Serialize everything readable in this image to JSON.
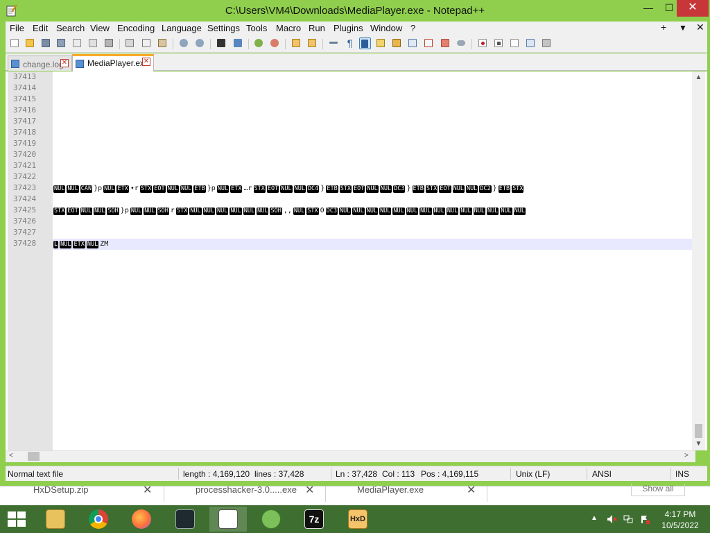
{
  "window": {
    "title": "C:\\Users\\VM4\\Downloads\\MediaPlayer.exe - Notepad++",
    "minimize_glyph": "—",
    "maximize_glyph": "☐",
    "close_glyph": "✕"
  },
  "menu": {
    "items": [
      "File",
      "Edit",
      "Search",
      "View",
      "Encoding",
      "Language",
      "Settings",
      "Tools",
      "Macro",
      "Run",
      "Plugins",
      "Window",
      "?"
    ],
    "right": [
      "+",
      "▼",
      "✕"
    ]
  },
  "toolbar": {
    "icons": [
      "new-file-icon",
      "open-file-icon",
      "save-icon",
      "save-all-icon",
      "close-icon",
      "close-all-icon",
      "print-icon",
      "cut-icon",
      "copy-icon",
      "paste-icon",
      "undo-icon",
      "redo-icon",
      "find-icon",
      "replace-icon",
      "zoom-in-icon",
      "zoom-out-icon",
      "sync-vertical-icon",
      "sync-horizontal-icon",
      "word-wrap-icon",
      "show-all-chars-icon",
      "indent-guide-icon",
      "udl-icon",
      "doc-map-icon",
      "function-list-icon",
      "folder-workspace-icon",
      "monitoring-icon",
      "record-macro-icon",
      "stop-record-icon",
      "play-macro-icon",
      "run-macro-multiple-icon",
      "save-macro-icon"
    ],
    "show_all_chars_glyph": "¶"
  },
  "tabs": [
    {
      "label": "change.log",
      "active": false
    },
    {
      "label": "MediaPlayer.exe",
      "active": true
    }
  ],
  "tab_close_glyph": "✕",
  "editor": {
    "line_numbers": [
      "37413",
      "37414",
      "37415",
      "37416",
      "37417",
      "37418",
      "37419",
      "37420",
      "37421",
      "37422",
      "37423",
      "37424",
      "37425",
      "37426",
      "37427",
      "37428"
    ],
    "current_line": "37428",
    "lines": [
      {
        "line": "37423",
        "tokens": [
          {
            "t": "c",
            "v": "NUL"
          },
          {
            "t": "c",
            "v": "NUL"
          },
          {
            "t": "c",
            "v": "CAN"
          },
          {
            "t": "s",
            "v": "}p"
          },
          {
            "t": "c",
            "v": "NUL"
          },
          {
            "t": "c",
            "v": "ETX"
          },
          {
            "t": "s",
            "v": "•r"
          },
          {
            "t": "c",
            "v": "STX"
          },
          {
            "t": "c",
            "v": "EOT"
          },
          {
            "t": "c",
            "v": "NUL"
          },
          {
            "t": "c",
            "v": "NUL"
          },
          {
            "t": "c",
            "v": "ETB"
          },
          {
            "t": "s",
            "v": "}p"
          },
          {
            "t": "c",
            "v": "NUL"
          },
          {
            "t": "c",
            "v": "ETX"
          },
          {
            "t": "s",
            "v": "…r"
          },
          {
            "t": "c",
            "v": "STX"
          },
          {
            "t": "c",
            "v": "EOT"
          },
          {
            "t": "c",
            "v": "NUL"
          },
          {
            "t": "c",
            "v": "NUL"
          },
          {
            "t": "c",
            "v": "DC4"
          },
          {
            "t": "s",
            "v": "}"
          },
          {
            "t": "c",
            "v": "ETB"
          },
          {
            "t": "c",
            "v": "STX"
          },
          {
            "t": "c",
            "v": "EOT"
          },
          {
            "t": "c",
            "v": "NUL"
          },
          {
            "t": "c",
            "v": "NUL"
          },
          {
            "t": "c",
            "v": "DC3"
          },
          {
            "t": "s",
            "v": "}"
          },
          {
            "t": "c",
            "v": "ETB"
          },
          {
            "t": "c",
            "v": "STX"
          },
          {
            "t": "c",
            "v": "EOT"
          },
          {
            "t": "c",
            "v": "NUL"
          },
          {
            "t": "c",
            "v": "NUL"
          },
          {
            "t": "c",
            "v": "DC2"
          },
          {
            "t": "s",
            "v": "}"
          },
          {
            "t": "c",
            "v": "ETB"
          },
          {
            "t": "c",
            "v": "STX"
          }
        ]
      },
      {
        "line": "37425",
        "tokens": [
          {
            "t": "c",
            "v": "STX"
          },
          {
            "t": "c",
            "v": "EOT"
          },
          {
            "t": "c",
            "v": "NUL"
          },
          {
            "t": "c",
            "v": "NUL"
          },
          {
            "t": "c",
            "v": "SOH"
          },
          {
            "t": "s",
            "v": "}p"
          },
          {
            "t": "c",
            "v": "NUL"
          },
          {
            "t": "c",
            "v": "NUL"
          },
          {
            "t": "c",
            "v": "SOH"
          },
          {
            "t": "s",
            "v": "r"
          },
          {
            "t": "c",
            "v": "STX"
          },
          {
            "t": "c",
            "v": "NUL"
          },
          {
            "t": "c",
            "v": "NUL"
          },
          {
            "t": "c",
            "v": "NUL"
          },
          {
            "t": "c",
            "v": "NUL"
          },
          {
            "t": "c",
            "v": "NUL"
          },
          {
            "t": "c",
            "v": "NUL"
          },
          {
            "t": "c",
            "v": "SOH"
          },
          {
            "t": "s",
            "v": ",,"
          },
          {
            "t": "c",
            "v": "NUL"
          },
          {
            "t": "c",
            "v": "STX"
          },
          {
            "t": "s",
            "v": "0"
          },
          {
            "t": "c",
            "v": "DC3"
          },
          {
            "t": "c",
            "v": "NUL"
          },
          {
            "t": "c",
            "v": "NUL"
          },
          {
            "t": "c",
            "v": "NUL"
          },
          {
            "t": "c",
            "v": "NUL"
          },
          {
            "t": "c",
            "v": "NUL"
          },
          {
            "t": "c",
            "v": "NUL"
          },
          {
            "t": "c",
            "v": "NUL"
          },
          {
            "t": "c",
            "v": "NUL"
          },
          {
            "t": "c",
            "v": "NUL"
          },
          {
            "t": "c",
            "v": "NUL"
          },
          {
            "t": "c",
            "v": "NUL"
          },
          {
            "t": "c",
            "v": "NUL"
          },
          {
            "t": "c",
            "v": "NUL"
          },
          {
            "t": "c",
            "v": "NUL"
          }
        ]
      },
      {
        "line": "37428",
        "tokens": [
          {
            "t": "c",
            "v": "L"
          },
          {
            "t": "c",
            "v": "NUL"
          },
          {
            "t": "c",
            "v": "ETX"
          },
          {
            "t": "c",
            "v": "NUL"
          },
          {
            "t": "s",
            "v": "ZM"
          }
        ]
      }
    ]
  },
  "scroll": {
    "up": "▲",
    "down": "▼",
    "left": "<",
    "right": ">"
  },
  "status": {
    "file_type": "Normal text file",
    "length": "length : 4,169,120",
    "lines": "lines : 37,428",
    "ln": "Ln : 37,428",
    "col": "Col : 113",
    "pos": "Pos : 4,169,115",
    "eol": "Unix (LF)",
    "encoding": "ANSI",
    "mode": "INS"
  },
  "downloads": {
    "items": [
      "HxDSetup.zip",
      "processhacker-3.0.....exe",
      "MediaPlayer.exe"
    ],
    "show_all": "Show all",
    "close_glyph": "✕"
  },
  "taskbar": {
    "apps": [
      "file-explorer-icon",
      "chrome-icon",
      "firefox-icon",
      "process-monitor-icon",
      "notepad-plus-plus-icon",
      "gecko-installer-icon",
      "7zip-icon",
      "hxd-icon"
    ],
    "seven_zip_label": "7z",
    "hxd_label": "HxD",
    "tray_up": "▲",
    "time": "4:17 PM",
    "date": "10/5/2022"
  },
  "colors": {
    "titlebar": "#8fcf4d",
    "close_button": "#c7373a",
    "tab_active_accent": "#f9a825",
    "taskbar": "#3e6e30",
    "current_line": "#e8e8ff"
  }
}
